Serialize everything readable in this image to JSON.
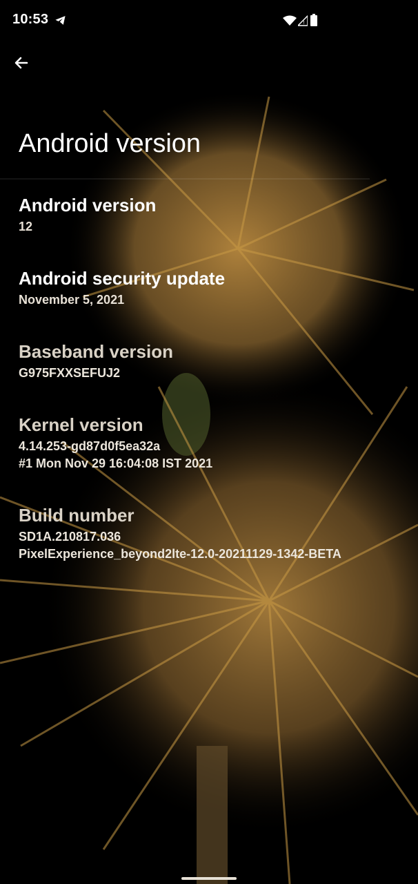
{
  "status_bar": {
    "time": "10:53",
    "icons": [
      "telegram-icon",
      "wifi-icon",
      "signal-icon",
      "battery-icon"
    ]
  },
  "header": {
    "back_icon": "arrow-back-icon",
    "title": "Android version"
  },
  "items": [
    {
      "title": "Android version",
      "summary": "12"
    },
    {
      "title": "Android security update",
      "summary": "November 5, 2021"
    },
    {
      "title": "Baseband version",
      "summary": "G975FXXSEFUJ2"
    },
    {
      "title": "Kernel version",
      "summary_lines": [
        "4.14.253-gd87d0f5ea32a",
        "#1 Mon Nov 29 16:04:08 IST 2021"
      ]
    },
    {
      "title": "Build number",
      "summary_lines": [
        "SD1A.210817.036",
        "PixelExperience_beyond2lte-12.0-20211129-1342-BETA"
      ]
    }
  ],
  "colors": {
    "background": "#000000",
    "wallpaper_accent": "#c99a45",
    "text_primary": "#ffffff"
  }
}
